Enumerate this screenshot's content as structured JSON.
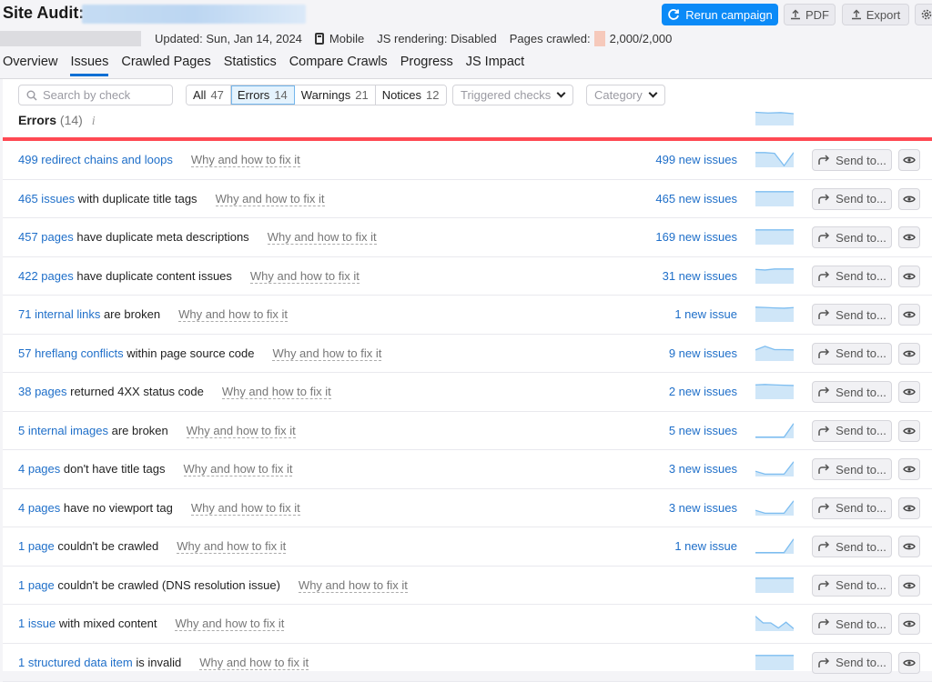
{
  "header": {
    "title": "Site Audit:",
    "updated": "Updated: Sun, Jan 14, 2024",
    "device": "Mobile",
    "js_rendering": "JS rendering: Disabled",
    "pages_crawled_label": "Pages crawled:",
    "pages_crawled_value": "2,000/2,000",
    "buttons": {
      "rerun": "Rerun campaign",
      "pdf": "PDF",
      "export": "Export"
    }
  },
  "tabs": [
    {
      "label": "Overview",
      "active": false
    },
    {
      "label": "Issues",
      "active": true
    },
    {
      "label": "Crawled Pages",
      "active": false
    },
    {
      "label": "Statistics",
      "active": false
    },
    {
      "label": "Compare Crawls",
      "active": false
    },
    {
      "label": "Progress",
      "active": false
    },
    {
      "label": "JS Impact",
      "active": false
    }
  ],
  "filters": {
    "search_placeholder": "Search by check",
    "segments": [
      {
        "label": "All",
        "count": "47",
        "active": false
      },
      {
        "label": "Errors",
        "count": "14",
        "active": true
      },
      {
        "label": "Warnings",
        "count": "21",
        "active": false
      },
      {
        "label": "Notices",
        "count": "12",
        "active": false
      }
    ],
    "triggered_checks": "Triggered checks",
    "category": "Category"
  },
  "section": {
    "title": "Errors",
    "count": "(14)",
    "info": "i"
  },
  "colors": {
    "primary": "#0b8af7",
    "link": "#1f6fc9",
    "error_line": "#ff4953",
    "spark_fill": "#cfe6f8",
    "spark_line": "#7dbdf0"
  },
  "why_label": "Why and how to fix it",
  "send_label": "Send to...",
  "header_trend": [
    0.9,
    0.85,
    0.88,
    0.8
  ],
  "issues": [
    {
      "link": "499 redirect chains and loops",
      "rest": "",
      "new": "499 new issues",
      "trend": [
        0.95,
        0.95,
        0.9,
        0.05,
        0.95
      ]
    },
    {
      "link": "465 issues",
      "rest": " with duplicate title tags",
      "new": "465 new issues",
      "trend": [
        0.95,
        0.95,
        0.95,
        0.95,
        0.95
      ]
    },
    {
      "link": "457 pages",
      "rest": " have duplicate meta descriptions",
      "new": "169 new issues",
      "trend": [
        0.95,
        0.95,
        0.95,
        0.95,
        0.95
      ]
    },
    {
      "link": "422 pages",
      "rest": " have duplicate content issues",
      "new": "31 new issues",
      "trend": [
        0.92,
        0.88,
        0.95,
        0.95,
        0.95
      ]
    },
    {
      "link": "71 internal links",
      "rest": " are broken",
      "new": "1 new issue",
      "trend": [
        0.95,
        0.93,
        0.9,
        0.88,
        0.92
      ]
    },
    {
      "link": "57 hreflang conflicts",
      "rest": " within page source code",
      "new": "9 new issues",
      "trend": [
        0.7,
        0.95,
        0.72,
        0.72,
        0.7
      ]
    },
    {
      "link": "38 pages",
      "rest": " returned 4XX status code",
      "new": "2 new issues",
      "trend": [
        0.92,
        0.95,
        0.92,
        0.9,
        0.88
      ]
    },
    {
      "link": "5 internal images",
      "rest": " are broken",
      "new": "5 new issues",
      "trend": [
        0.02,
        0.02,
        0.02,
        0.02,
        0.95
      ]
    },
    {
      "link": "4 pages",
      "rest": " don't have title tags",
      "new": "3 new issues",
      "trend": [
        0.3,
        0.1,
        0.1,
        0.1,
        0.95
      ]
    },
    {
      "link": "4 pages",
      "rest": " have no viewport tag",
      "new": "3 new issues",
      "trend": [
        0.3,
        0.1,
        0.1,
        0.1,
        0.95
      ]
    },
    {
      "link": "1 page",
      "rest": " couldn't be crawled",
      "new": "1 new issue",
      "trend": [
        0.02,
        0.02,
        0.02,
        0.02,
        0.95
      ]
    },
    {
      "link": "1 page",
      "rest": " couldn't be crawled (DNS resolution issue)",
      "new": "",
      "trend": [
        0.95,
        0.95,
        0.95,
        0.95,
        0.95
      ]
    },
    {
      "link": "1 issue",
      "rest": " with mixed content",
      "new": "",
      "trend": [
        0.95,
        0.5,
        0.5,
        0.15,
        0.55,
        0.1
      ]
    },
    {
      "link": "1 structured data item",
      "rest": " is invalid",
      "new": "",
      "trend": [
        0.95,
        0.95,
        0.95,
        0.95,
        0.95
      ]
    }
  ]
}
